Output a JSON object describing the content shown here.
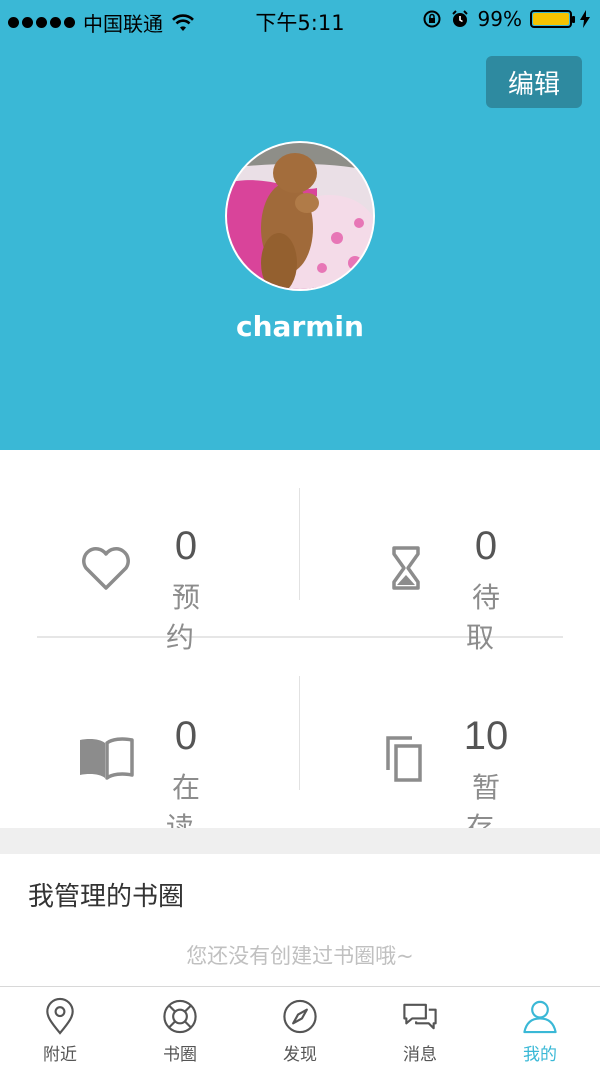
{
  "statusbar": {
    "carrier": "中国联通",
    "time": "下午5:11",
    "battery": "99%"
  },
  "header": {
    "edit_label": "编辑",
    "username": "charmin"
  },
  "stats": [
    {
      "value": "0",
      "label": "预约",
      "icon": "heart-icon"
    },
    {
      "value": "0",
      "label": "待取",
      "icon": "hourglass-icon"
    },
    {
      "value": "0",
      "label": "在读",
      "icon": "open-book-icon"
    },
    {
      "value": "10",
      "label": "暂存",
      "icon": "copy-icon"
    }
  ],
  "section": {
    "title": "我管理的书圈",
    "empty_text": "您还没有创建过书圈哦~"
  },
  "tabbar": {
    "items": [
      {
        "label": "附近",
        "icon": "location-pin-icon"
      },
      {
        "label": "书圈",
        "icon": "life-ring-icon"
      },
      {
        "label": "发现",
        "icon": "compass-icon"
      },
      {
        "label": "消息",
        "icon": "chat-bubbles-icon"
      },
      {
        "label": "我的",
        "icon": "person-icon"
      }
    ],
    "active_index": 4
  },
  "colors": {
    "header_bg": "#3ab8d6",
    "edit_button_bg": "#2e8aa0",
    "active_tab": "#3ab8d6"
  }
}
